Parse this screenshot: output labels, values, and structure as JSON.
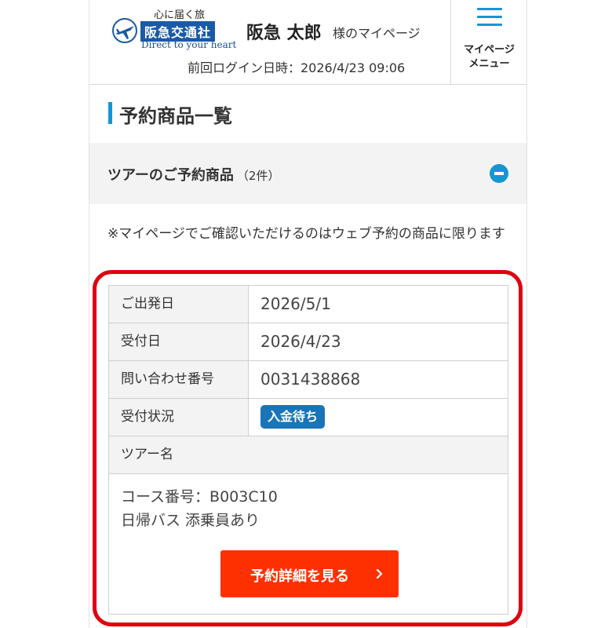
{
  "header": {
    "logo_tagline": "心に届く旅",
    "logo_name": "阪急交通社",
    "logo_english": "Direct to your heart",
    "user_name": "阪急 太郎",
    "user_suffix": "様のマイページ",
    "last_login": "前回ログイン日時：2026/4/23 09:06",
    "menu_label_line1": "マイページ",
    "menu_label_line2": "メニュー"
  },
  "page_title": "予約商品一覧",
  "accordion": {
    "title": "ツアーのご予約商品",
    "count": "（2件）"
  },
  "note": "※マイページでご確認いただけるのはウェブ予約の商品に限ります",
  "reservation": {
    "rows": [
      {
        "label": "ご出発日",
        "value": "2026/5/1"
      },
      {
        "label": "受付日",
        "value": "2026/4/23"
      },
      {
        "label": "問い合わせ番号",
        "value": "0031438868"
      },
      {
        "label": "受付状況",
        "value": "入金待ち"
      }
    ],
    "tour_label": "ツアー名",
    "course_number": "コース番号：B003C10",
    "tour_name": "日帰バス 添乗員あり",
    "detail_button": "予約詳細を見る"
  },
  "colors": {
    "accent_blue": "#1596d3",
    "logo_blue": "#1a5aa6",
    "status_badge": "#1a75b8",
    "highlight_red": "#e0000f",
    "button_red": "#ff3000"
  },
  "icons": {
    "menu": "hamburger-icon",
    "accordion": "minus-circle-icon",
    "button": "chevron-right-icon",
    "logo": "airplane-logo-icon"
  }
}
